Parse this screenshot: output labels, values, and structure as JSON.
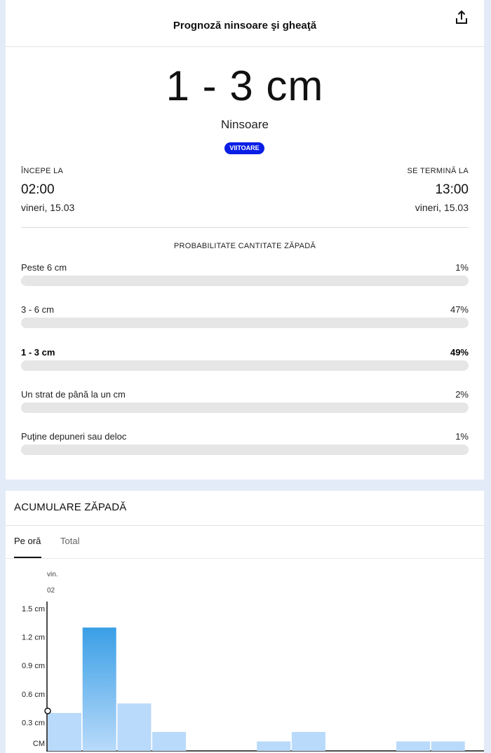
{
  "header": {
    "title": "Prognoză ninsoare şi gheaţă",
    "share_icon": "share-icon"
  },
  "summary": {
    "amount": "1 - 3 cm",
    "type": "Ninsoare",
    "badge": "VIITOARE",
    "badge_color": "#0a1ee6"
  },
  "start": {
    "label": "ÎNCEPE LA",
    "time": "02:00",
    "date": "vineri, 15.03"
  },
  "end": {
    "label": "SE TERMINĂ LA",
    "time": "13:00",
    "date": "vineri, 15.03"
  },
  "probability": {
    "title": "PROBABILITATE CANTITATE ZĂPADĂ",
    "rows": [
      {
        "label": "Peste 6 cm",
        "value": "1%",
        "percent": 1,
        "highlight": false
      },
      {
        "label": "3 - 6 cm",
        "value": "47%",
        "percent": 47,
        "highlight": false
      },
      {
        "label": "1 - 3 cm",
        "value": "49%",
        "percent": 49,
        "highlight": true
      },
      {
        "label": "Un strat de până la un cm",
        "value": "2%",
        "percent": 2,
        "highlight": false
      },
      {
        "label": "Puţine depuneri sau deloc",
        "value": "1%",
        "percent": 1,
        "highlight": false
      }
    ]
  },
  "accumulation": {
    "title": "ACUMULARE ZĂPADĂ",
    "tabs": [
      {
        "label": "Pe oră",
        "active": true
      },
      {
        "label": "Total",
        "active": false
      }
    ]
  },
  "chart_data": {
    "type": "bar",
    "x_top_label": [
      "vin.",
      "02"
    ],
    "y_ticks": [
      "1.5 cm",
      "1.2 cm",
      "0.9 cm",
      "0.6 cm",
      "0.3 cm",
      "CM"
    ],
    "ylim": [
      0,
      1.5
    ],
    "values": [
      0.4,
      1.3,
      0.5,
      0.2,
      0,
      0,
      0.1,
      0.2,
      0,
      0,
      0.1,
      0.1
    ],
    "highlight_index": 1,
    "bar_color": "#b9dafa",
    "highlight_color": "#3a9fe6"
  }
}
